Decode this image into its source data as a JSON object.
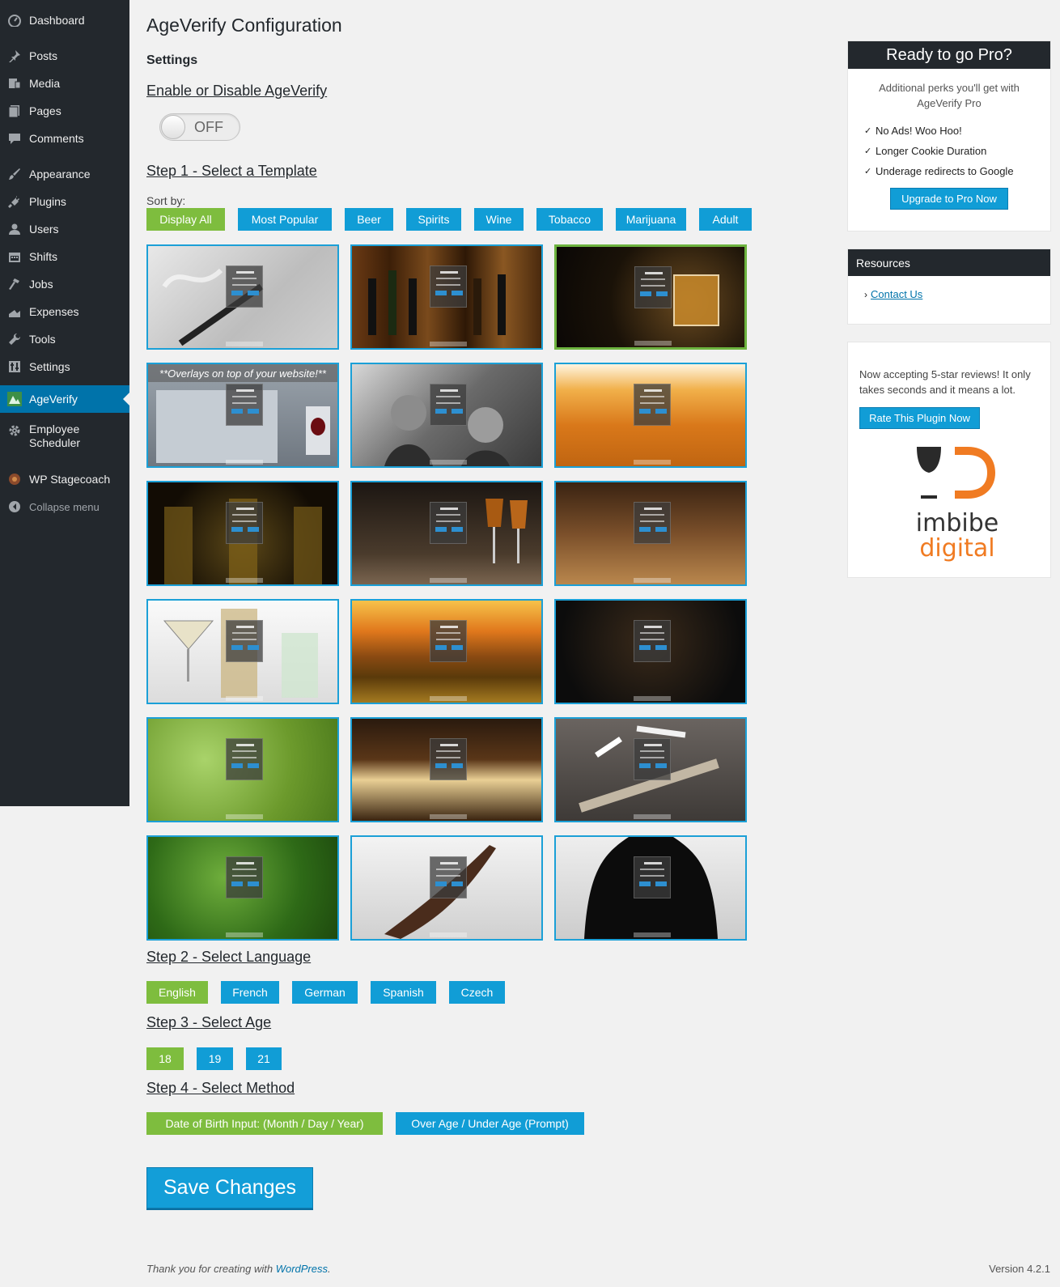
{
  "sidebar": {
    "items": [
      {
        "label": "Dashboard",
        "icon": "dashboard-icon"
      },
      {
        "label": "Posts",
        "icon": "pin-icon"
      },
      {
        "label": "Media",
        "icon": "media-icon"
      },
      {
        "label": "Pages",
        "icon": "pages-icon"
      },
      {
        "label": "Comments",
        "icon": "comment-icon"
      },
      {
        "label": "Appearance",
        "icon": "brush-icon"
      },
      {
        "label": "Plugins",
        "icon": "plug-icon"
      },
      {
        "label": "Users",
        "icon": "user-icon"
      },
      {
        "label": "Shifts",
        "icon": "calendar-icon"
      },
      {
        "label": "Jobs",
        "icon": "hammer-icon"
      },
      {
        "label": "Expenses",
        "icon": "chart-icon"
      },
      {
        "label": "Tools",
        "icon": "wrench-icon"
      },
      {
        "label": "Settings",
        "icon": "settings-icon"
      },
      {
        "label": "AgeVerify",
        "icon": "ageverify-icon"
      },
      {
        "label": "Employee Scheduler",
        "icon": "gear-icon"
      },
      {
        "label": "WP Stagecoach",
        "icon": "stagecoach-icon"
      },
      {
        "label": "Collapse menu",
        "icon": "collapse-icon"
      }
    ]
  },
  "main": {
    "title": "AgeVerify Configuration",
    "section": "Settings",
    "enable_heading": "Enable or Disable AgeVerify",
    "toggle_state": "OFF",
    "step1": "Step 1 - Select a Template",
    "sort_label": "Sort by:",
    "sort_filters": [
      "Display All",
      "Most Popular",
      "Beer",
      "Spirits",
      "Wine",
      "Tobacco",
      "Marijuana",
      "Adult"
    ],
    "overlay_banner": "**Overlays on top of your website!**",
    "step2": "Step 2 - Select Language",
    "languages": [
      "English",
      "French",
      "German",
      "Spanish",
      "Czech"
    ],
    "step3": "Step 3 - Select Age",
    "ages": [
      "18",
      "19",
      "21"
    ],
    "step4": "Step 4 - Select Method",
    "methods": [
      "Date of Birth Input: (Month / Day / Year)",
      "Over Age / Under Age (Prompt)"
    ],
    "save_label": "Save Changes"
  },
  "pro_box": {
    "title": "Ready to go Pro?",
    "intro": "Additional perks you'll get with AgeVerify Pro",
    "perks": [
      "No Ads! Woo Hoo!",
      "Longer Cookie Duration",
      "Underage redirects to Google"
    ],
    "button": "Upgrade to Pro Now"
  },
  "resources_box": {
    "title": "Resources",
    "link": "Contact Us"
  },
  "review_box": {
    "text": "Now accepting 5-star reviews! It only takes seconds and it means a lot.",
    "button": "Rate This Plugin Now",
    "logo_word1": "imbibe",
    "logo_word2": "digital"
  },
  "footer": {
    "thanks_prefix": "Thank you for creating with ",
    "thanks_link": "WordPress",
    "thanks_suffix": ".",
    "version": "Version 4.2.1"
  },
  "colors": {
    "selected_green": "#7ebd3e",
    "button_blue": "#119dd6",
    "admin_dark": "#23282d",
    "active_menu": "#0073aa"
  }
}
